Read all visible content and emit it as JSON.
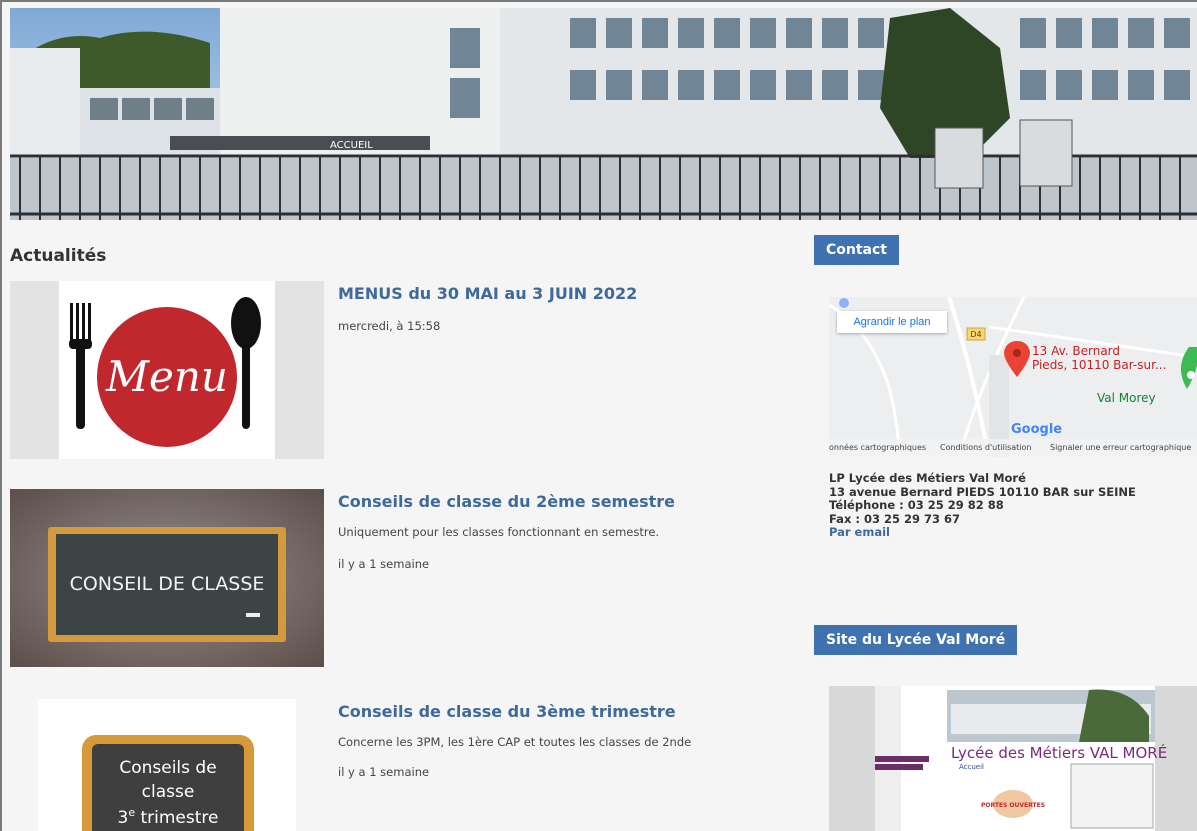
{
  "banner": {
    "sign_text": "ACCUEIL"
  },
  "news": {
    "heading": "Actualités",
    "articles": [
      {
        "title": "MENUS du 30 MAI au 3 JUIN 2022",
        "summary": "",
        "date": "mercredi, à 15:58",
        "image_text": "Menu"
      },
      {
        "title": "Conseils de classe du 2ème semestre",
        "summary": "Uniquement pour les classes fonctionnant en semestre.",
        "date": "il y a 1 semaine",
        "image_text": "CONSEIL DE CLASSE"
      },
      {
        "title": "Conseils de classe du 3ème trimestre",
        "summary": "Concerne les 3PM, les 1ère CAP et toutes les classes de 2nde",
        "date": "il y a 1 semaine",
        "image_line1": "Conseils de",
        "image_line2": "classe",
        "image_line3_num": "3",
        "image_line3_sup": "e",
        "image_line3_rest": " trimestre"
      }
    ]
  },
  "contact": {
    "heading": "Contact",
    "map": {
      "enlarge_button": "Agrandir le plan",
      "road_label": "D4",
      "pin_address_line1": "13 Av. Bernard",
      "pin_address_line2": "Pieds, 10110 Bar-sur...",
      "place_label": "Val Morey",
      "google_logo": "Google",
      "footer_data": "onnées cartographiques",
      "footer_terms": "Conditions d'utilisation",
      "footer_report": "Signaler une erreur cartographique"
    },
    "name": "LP Lycée des Métiers Val Moré",
    "address": "13 avenue Bernard PIEDS 10110 BAR sur SEINE",
    "phone": "Téléphone : 03 25 29 82 88",
    "fax": "Fax : 03 25 29 73 67",
    "email_link": "Par email"
  },
  "site": {
    "heading": "Site du Lycée Val Moré",
    "preview_title": "Lycée des Métiers VAL MORÉ",
    "preview_nav": "Accueil",
    "preview_badge": "PORTES OUVERTES"
  },
  "colors": {
    "accent": "#3f72af",
    "link": "#3d6a9a",
    "menu_red": "#c0282e"
  }
}
